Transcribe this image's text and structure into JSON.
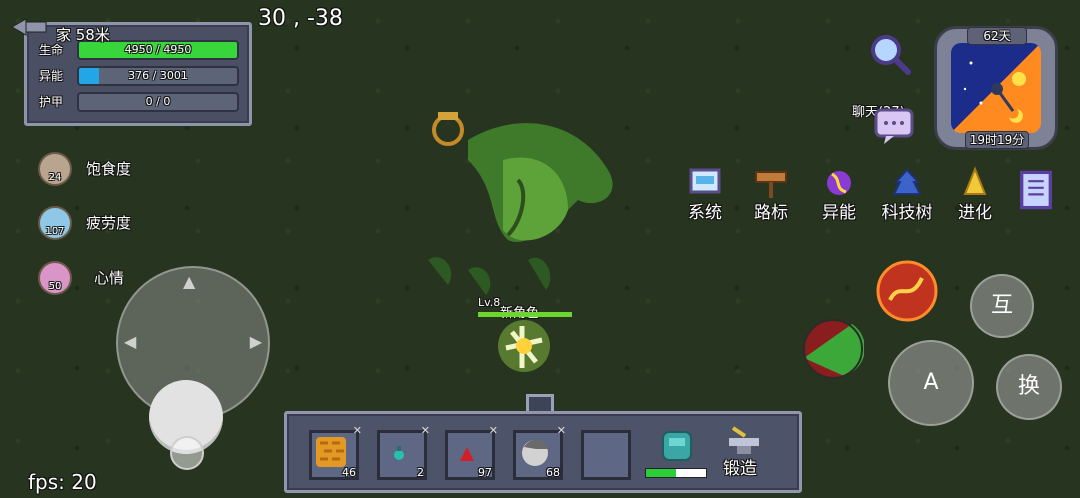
{
  "hud": {
    "home_distance": "家 58米",
    "coords": "30 , -38",
    "fps": "fps: 20"
  },
  "stats": {
    "hp": {
      "label": "生命",
      "value": "4950 / 4950",
      "fraction": 1.0,
      "color": "#38d63a"
    },
    "energy": {
      "label": "异能",
      "value": "376 / 3001",
      "fraction": 0.125,
      "color": "#22a6e8"
    },
    "armor": {
      "label": "护甲",
      "value": "0 / 0",
      "fraction": 0.0,
      "color": "#5d6478"
    }
  },
  "status": [
    {
      "label": "饱食度",
      "value": "24",
      "icon": "food-icon"
    },
    {
      "label": "疲劳度",
      "value": "107",
      "icon": "fatigue-icon"
    },
    {
      "label": "心情",
      "value": "50",
      "icon": "heart-icon"
    }
  ],
  "player": {
    "level": "Lv.8",
    "name": "新角色",
    "hp_fraction": 1.0
  },
  "hotbar": {
    "slots": [
      {
        "count": "46",
        "icon": "honeycomb-icon"
      },
      {
        "count": "2",
        "icon": "blue-potion-icon"
      },
      {
        "count": "97",
        "icon": "red-potion-icon"
      },
      {
        "count": "68",
        "icon": "portrait-icon"
      },
      {
        "count": "",
        "icon": "empty-slot"
      }
    ],
    "backpack_fill": 0.5,
    "forge_label": "锻造"
  },
  "clock": {
    "days": "62天",
    "time": "19时19分"
  },
  "chat": {
    "label": "聊天(27)"
  },
  "menu": [
    {
      "label": "系统",
      "icon": "monitor-icon"
    },
    {
      "label": "路标",
      "icon": "signpost-icon"
    },
    {
      "label": "异能",
      "icon": "ability-icon"
    },
    {
      "label": "科技树",
      "icon": "tech-tree-icon"
    },
    {
      "label": "进化",
      "icon": "evolution-icon"
    },
    {
      "label": "",
      "icon": "scroll-icon"
    }
  ],
  "buttons": {
    "interact": "互",
    "attack": "A",
    "swap": "换"
  },
  "colors": {
    "panel": "#4a4f63",
    "panel_border": "#8e94aa",
    "grass": "#27341f"
  }
}
